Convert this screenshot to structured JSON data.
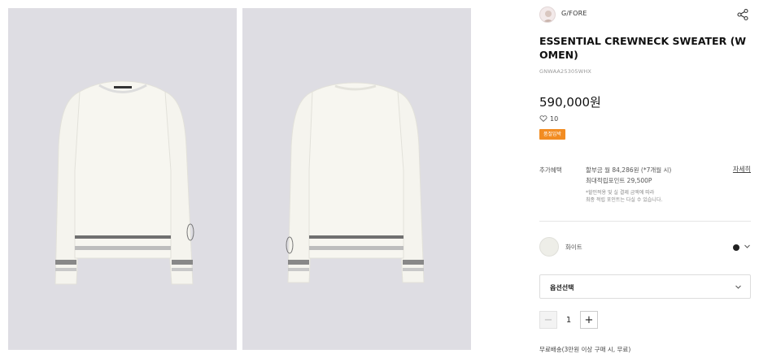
{
  "product": {
    "brand_name": "G/FORE",
    "title": "ESSENTIAL CREWNECK SWEATER (WOMEN)",
    "code": "GNWAA25305WHX",
    "price": "590,000원",
    "like_count": "10",
    "badge": "품절임박"
  },
  "benefits": {
    "label": "추가혜택",
    "installment": "할부금 월 84,286원 (*7개월 시)",
    "points": "최대적립포인트 29,500P",
    "note_line1": "*할인적용 및 실 결제 금액에 따라",
    "note_line2": "최종 적립 포인트는 다실 수 있습니다.",
    "details_link": "자세히"
  },
  "color": {
    "name": "화이트",
    "swatch": "#eeeee8",
    "selected_dot": "#222222"
  },
  "option": {
    "label": "옵션선택"
  },
  "quantity": {
    "minus": "−",
    "value": "1",
    "plus": "+"
  },
  "shipping": "무료배송(3만원 이상 구매 시, 무료)",
  "colors": {
    "badge": "#f28c22",
    "photo_bg": "#dedde3",
    "sweater": "#f6f5ef"
  },
  "icons": [
    "share-icon",
    "heart-icon",
    "chevron-down-icon"
  ]
}
